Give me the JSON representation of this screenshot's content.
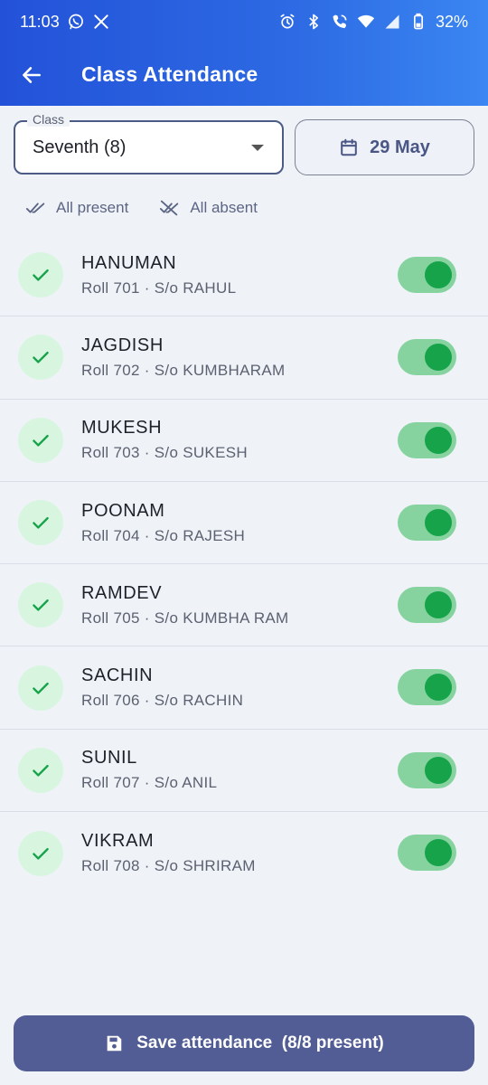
{
  "status_bar": {
    "time": "11:03",
    "battery": "32%",
    "left_icons": [
      "whatsapp-icon",
      "x-icon"
    ],
    "right_icons": [
      "alarm-icon",
      "bluetooth-icon",
      "wifi-calling-icon",
      "wifi-icon",
      "signal-icon",
      "battery-icon"
    ]
  },
  "app_bar": {
    "title": "Class Attendance",
    "back_icon": "arrow-left-icon",
    "background": "#2352d9"
  },
  "filters": {
    "class_label": "Class",
    "class_value": "Seventh (8)",
    "date_value": "29 May",
    "date_icon": "calendar-icon"
  },
  "quick_actions": {
    "all_present": "All present",
    "all_absent": "All absent"
  },
  "students": [
    {
      "name": "HANUMAN",
      "detail": "Roll 701 · S/o RAHUL",
      "present": true
    },
    {
      "name": "JAGDISH",
      "detail": "Roll 702 · S/o KUMBHARAM",
      "present": true
    },
    {
      "name": "MUKESH",
      "detail": "Roll 703 · S/o SUKESH",
      "present": true
    },
    {
      "name": "POONAM",
      "detail": "Roll 704 · S/o RAJESH",
      "present": true
    },
    {
      "name": "RAMDEV",
      "detail": "Roll 705 · S/o KUMBHA RAM",
      "present": true
    },
    {
      "name": "SACHIN",
      "detail": "Roll 706 · S/o RACHIN",
      "present": true
    },
    {
      "name": "SUNIL",
      "detail": "Roll 707 · S/o ANIL",
      "present": true
    },
    {
      "name": "VIKRAM",
      "detail": "Roll 708 · S/o SHRIRAM",
      "present": true
    }
  ],
  "colors": {
    "present_green": "#16a34a",
    "present_bg": "#d8f6df",
    "toggle_track": "#86d3a0",
    "primary_button": "#525d95"
  },
  "save_button": {
    "label": "Save attendance  (8/8 present)",
    "icon": "save-icon"
  }
}
